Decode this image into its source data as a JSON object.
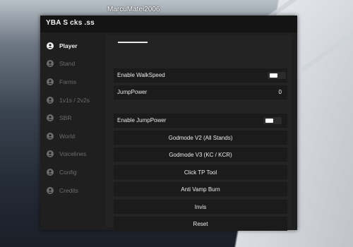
{
  "overlay": {
    "username": "MarcuMatei2006"
  },
  "window": {
    "title": "YBA S  cks  .ss"
  },
  "sidebar": {
    "items": [
      {
        "label": "Player",
        "icon": "user-circle-icon",
        "active": true
      },
      {
        "label": "Stand",
        "icon": "user-circle-icon",
        "active": false
      },
      {
        "label": "Farms",
        "icon": "user-circle-icon",
        "active": false
      },
      {
        "label": "1v1s / 2v2s",
        "icon": "user-circle-icon",
        "active": false
      },
      {
        "label": "SBR",
        "icon": "user-circle-icon",
        "active": false
      },
      {
        "label": "World",
        "icon": "user-circle-icon",
        "active": false
      },
      {
        "label": "Voicelines",
        "icon": "user-circle-icon",
        "active": false
      },
      {
        "label": "Config",
        "icon": "user-circle-icon",
        "active": false
      },
      {
        "label": "Credits",
        "icon": "user-circle-icon",
        "active": false
      }
    ]
  },
  "player": {
    "walkspeed_toggle_label": "Enable WalkSpeed",
    "jumppower_label": "JumpPower",
    "jumppower_value": "0",
    "jumppower_toggle_label": "Enable JumpPower",
    "buttons": [
      "Godmode V2 (All Stands)",
      "Godmode V3 (KC / KCR)",
      "Click TP Tool",
      "Anti Vamp Burn",
      "Invis",
      "Reset"
    ]
  },
  "colors": {
    "window_bg": "#1f1f1f",
    "titlebar_bg": "#141414",
    "content_bg": "#232323",
    "row_bg": "#1b1b1b",
    "active_text": "#f0f0f0",
    "inactive_text": "#6c6c6c"
  }
}
